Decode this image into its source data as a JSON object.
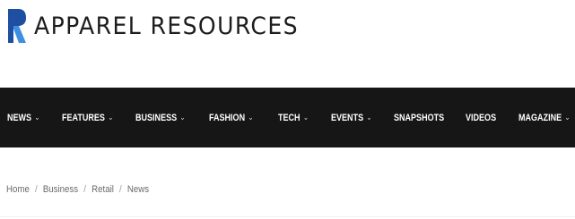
{
  "brand": {
    "name": "APPAREL RESOURCES",
    "logo_icon": "r-logo-mark-icon",
    "logo_colors": {
      "dark": "#1f4fa3",
      "light": "#3f8fe0"
    }
  },
  "nav": {
    "background": "#161616",
    "items": [
      {
        "label": "NEWS",
        "dropdown": true
      },
      {
        "label": "FEATURES",
        "dropdown": true
      },
      {
        "label": "BUSINESS",
        "dropdown": true
      },
      {
        "label": "FASHION",
        "dropdown": true
      },
      {
        "label": "TECH",
        "dropdown": true
      },
      {
        "label": "EVENTS",
        "dropdown": true
      },
      {
        "label": "SNAPSHOTS",
        "dropdown": false
      },
      {
        "label": "VIDEOS",
        "dropdown": false
      },
      {
        "label": "MAGAZINE",
        "dropdown": true
      }
    ],
    "chevron_glyph": "⌄"
  },
  "breadcrumb": {
    "separator": "/",
    "items": [
      "Home",
      "Business",
      "Retail",
      "News"
    ]
  }
}
